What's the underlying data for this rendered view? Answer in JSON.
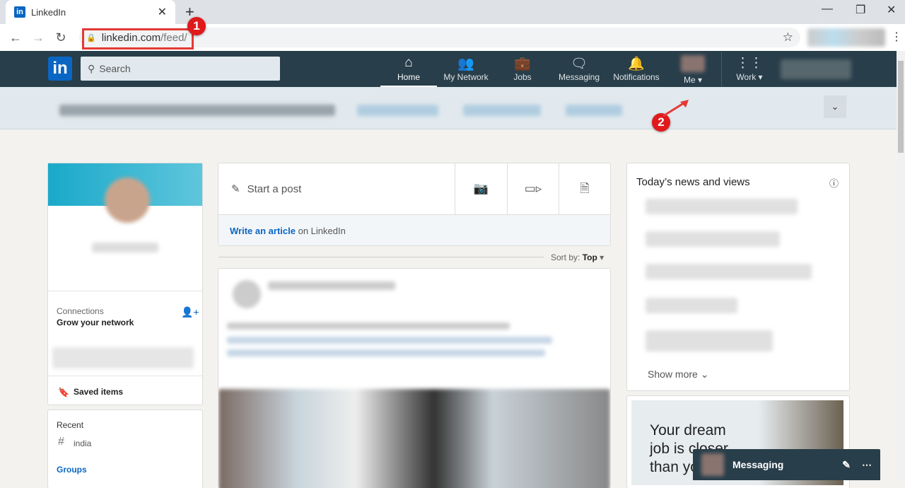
{
  "browser": {
    "tab_title": "LinkedIn",
    "url_domain": "linkedin.com",
    "url_path": "/feed/"
  },
  "annotations": [
    "1",
    "2"
  ],
  "nav": {
    "search_placeholder": "Search",
    "logo": "in",
    "items": [
      {
        "label": "Home",
        "icon": "home-icon"
      },
      {
        "label": "My Network",
        "icon": "network-icon"
      },
      {
        "label": "Jobs",
        "icon": "briefcase-icon"
      },
      {
        "label": "Messaging",
        "icon": "messaging-icon"
      },
      {
        "label": "Notifications",
        "icon": "bell-icon"
      }
    ],
    "me": "Me",
    "work": "Work"
  },
  "profile": {
    "connections_label": "Connections",
    "grow": "Grow your network",
    "saved": "Saved items"
  },
  "recent": {
    "title": "Recent",
    "hashtag": "india",
    "groups": "Groups"
  },
  "share": {
    "start_post": "Start a post",
    "write_article": "Write an article",
    "on_linkedin": "on LinkedIn",
    "sort_by": "Sort by:",
    "sort_value": "Top"
  },
  "news": {
    "title": "Today’s news and views",
    "show_more": "Show more"
  },
  "ad": {
    "text": "Your dream job is closer than you"
  },
  "messaging": {
    "label": "Messaging"
  },
  "colors": {
    "nav_bg": "#283e4a",
    "brand": "#0a66c2",
    "annotation": "#e53935"
  }
}
